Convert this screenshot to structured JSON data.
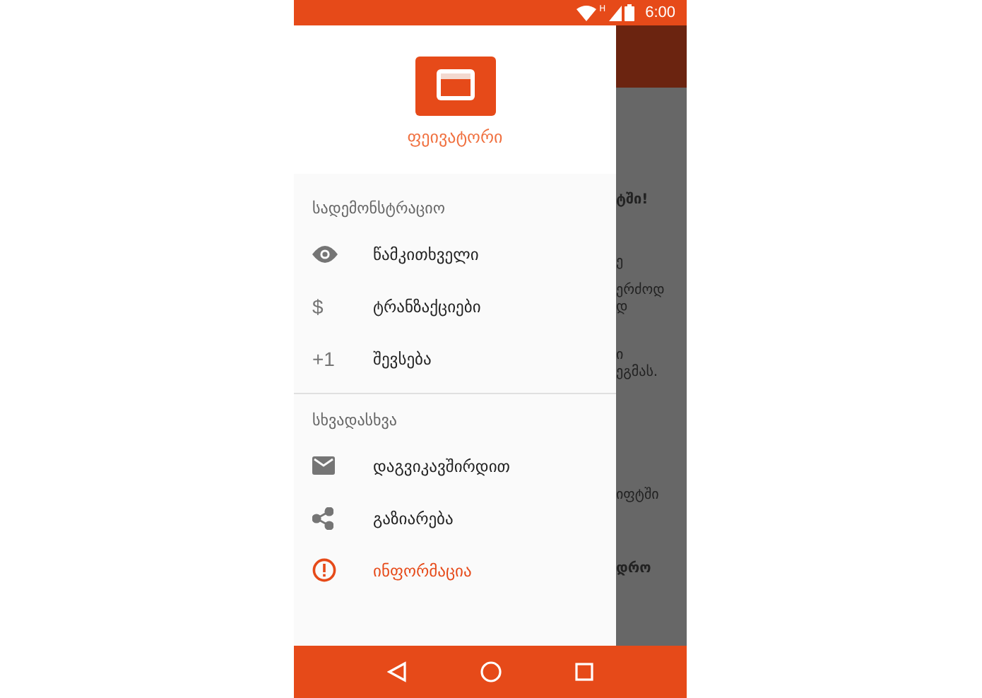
{
  "status_bar": {
    "network": "H",
    "time": "6:00"
  },
  "drawer": {
    "app_name": "ფეივატორი",
    "sections": [
      {
        "title": "სადემონსტრაციო",
        "items": [
          {
            "kind": "eye",
            "label": "წამკითხველი",
            "selected": false
          },
          {
            "kind": "glyph",
            "icon_text": "$",
            "label": "ტრანზაქციები",
            "selected": false
          },
          {
            "kind": "glyph",
            "icon_text": "+1",
            "label": "შევსება",
            "selected": false
          }
        ]
      },
      {
        "title": "სხვადასხვა",
        "items": [
          {
            "kind": "mail",
            "label": "დაგვიკავშირდით",
            "selected": false
          },
          {
            "kind": "share",
            "label": "გაზიარება",
            "selected": false
          },
          {
            "kind": "info",
            "label": "ინფორმაცია",
            "selected": true
          }
        ]
      }
    ]
  },
  "background_content": [
    {
      "text": "ტში!",
      "bold": true
    },
    {
      "text": "ე",
      "bold": false
    },
    {
      "text": "ერძოდ",
      "bold": false
    },
    {
      "text": "დ",
      "bold": false
    },
    {
      "text": "ი",
      "bold": false
    },
    {
      "text": "ეგმას.",
      "bold": false
    },
    {
      "text": "იფტში",
      "bold": false
    },
    {
      "text": "დრო",
      "bold": true
    }
  ]
}
